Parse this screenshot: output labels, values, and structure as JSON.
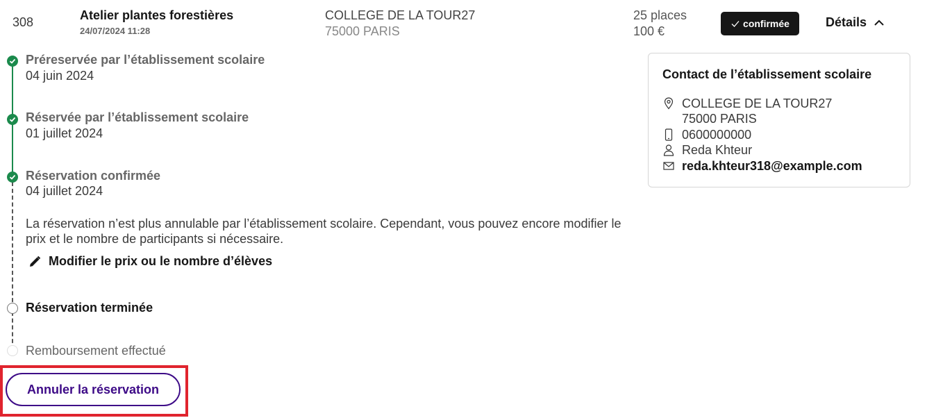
{
  "booking": {
    "id": "308",
    "title": "Atelier plantes forestières",
    "date": "24/07/2024 11:28",
    "school_name": "COLLEGE DE LA TOUR27",
    "school_city": "75000 PARIS",
    "places": "25 places",
    "price": "100 €",
    "status": "confirmée",
    "details_label": "Détails"
  },
  "timeline": {
    "steps": [
      {
        "title": "Préreservée par l’établissement scolaire",
        "date": "04 juin 2024"
      },
      {
        "title": "Réservée par l’établissement scolaire",
        "date": "01 juillet 2024"
      },
      {
        "title": "Réservation confirmée",
        "date": "04 juillet 2024"
      }
    ],
    "info_text": "La réservation n’est plus annulable par l’établissement scolaire. Cependant, vous pouvez encore modifier le prix et le nombre de participants si nécessaire.",
    "edit_label": "Modifier le prix ou le nombre d’élèves",
    "ended_label": "Réservation terminée",
    "refund_label": "Remboursement effectué"
  },
  "actions": {
    "cancel_label": "Annuler la réservation"
  },
  "contact": {
    "title": "Contact de l’établissement scolaire",
    "school_name": "COLLEGE DE LA TOUR27",
    "school_city": "75000 PARIS",
    "phone": "0600000000",
    "person": "Reda Khteur",
    "email": "reda.khteur318@example.com"
  },
  "colors": {
    "accent": "#3d0a87",
    "success": "#1b8a4c",
    "highlight": "#e0242e",
    "badge_bg": "#161616"
  },
  "icons": [
    "check-icon",
    "chevron-up-icon",
    "pencil-icon",
    "location-icon",
    "phone-icon",
    "user-icon",
    "mail-icon"
  ]
}
